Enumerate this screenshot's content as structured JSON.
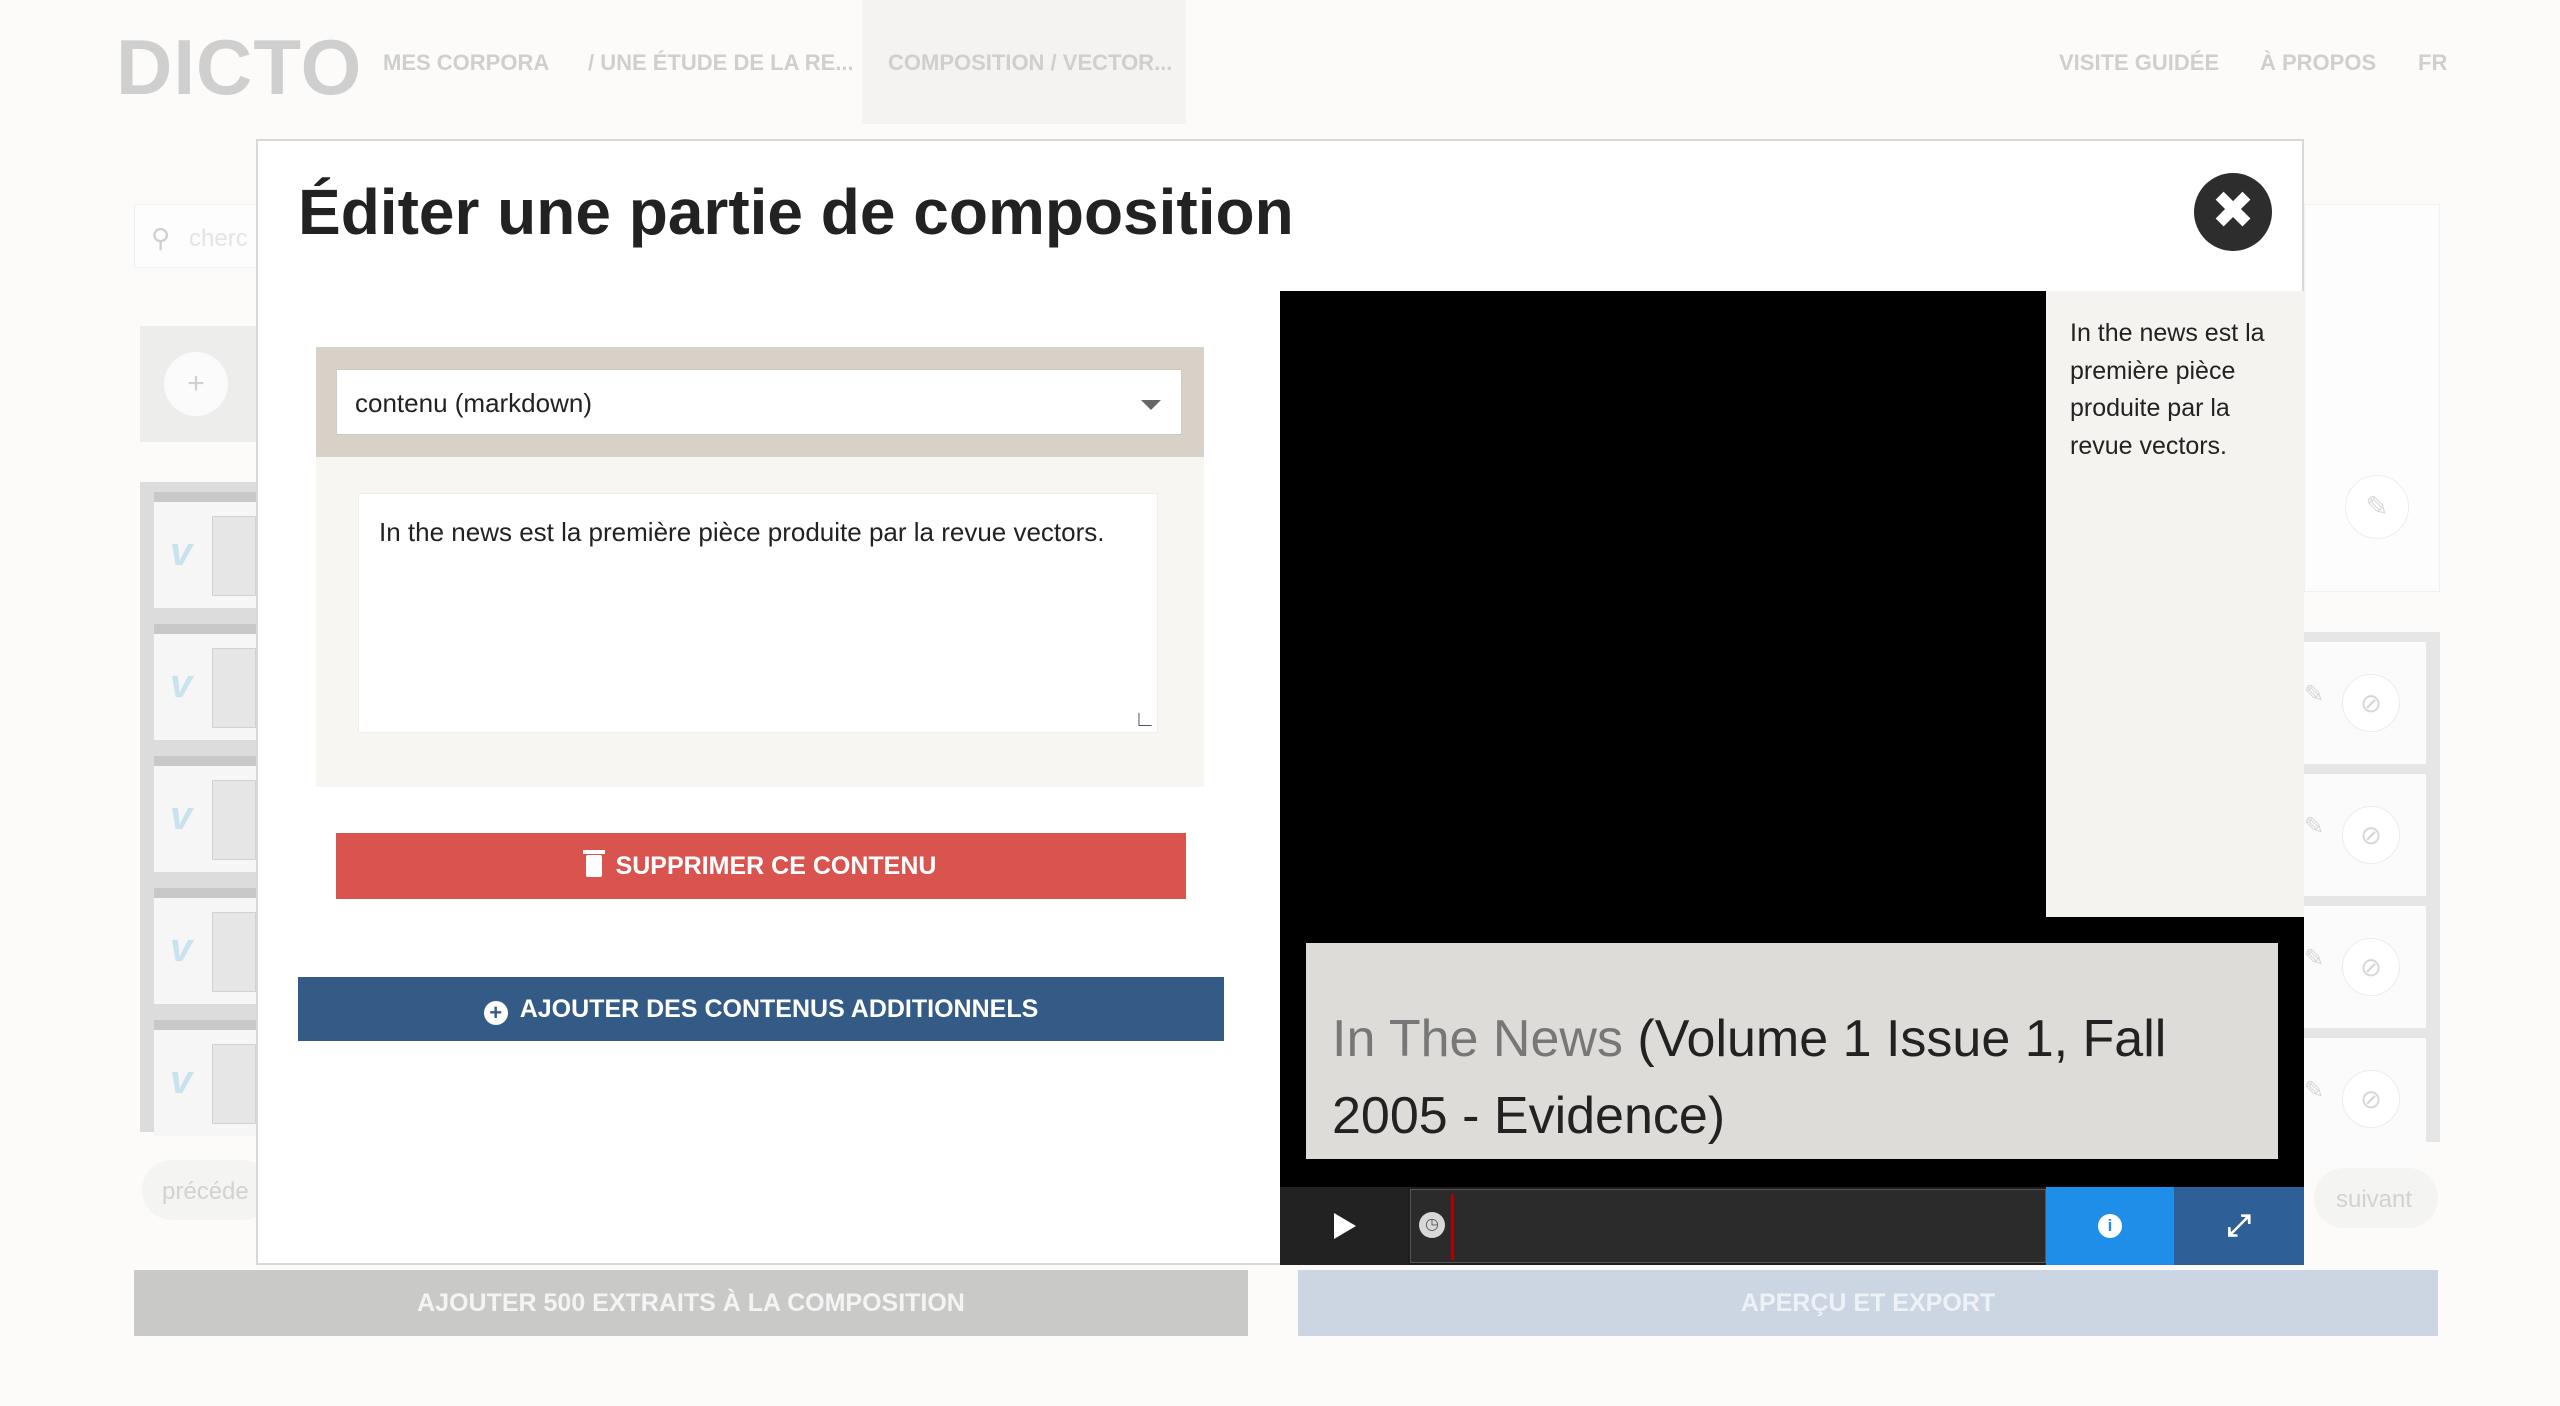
{
  "app": {
    "logo": "DICTO",
    "nav": {
      "corpora": "MES CORPORA",
      "study": "/ UNE ÉTUDE DE LA RE...",
      "composition": "COMPOSITION / VECTOR...",
      "tour": "VISITE GUIDÉE",
      "about": "À PROPOS",
      "lang": "FR"
    }
  },
  "background": {
    "search_placeholder": "cherc",
    "prev_label": "précéde",
    "next_label": "suivant",
    "add_extracts_label": "AJOUTER 500 EXTRAITS À LA COMPOSITION",
    "preview_export_label": "APERÇU ET EXPORT"
  },
  "modal": {
    "title": "Éditer une partie de composition",
    "content_type": "contenu (markdown)",
    "markdown_value": "In the news est la première pièce produite par la revue vectors.",
    "delete_label": "SUPPRIMER CE CONTENU",
    "add_more_label": "AJOUTER DES CONTENUS ADDITIONNELS"
  },
  "player": {
    "annotation_text": "In the news est la première pièce produite par la revue vectors.",
    "caption_name": "In The News",
    "caption_detail": " (Volume 1 Issue 1, Fall 2005 - Evidence)"
  },
  "colors": {
    "delete": "#d9534f",
    "add_more": "#335b85",
    "info": "#1f8ee8",
    "fullscreen": "#2e5f96"
  }
}
